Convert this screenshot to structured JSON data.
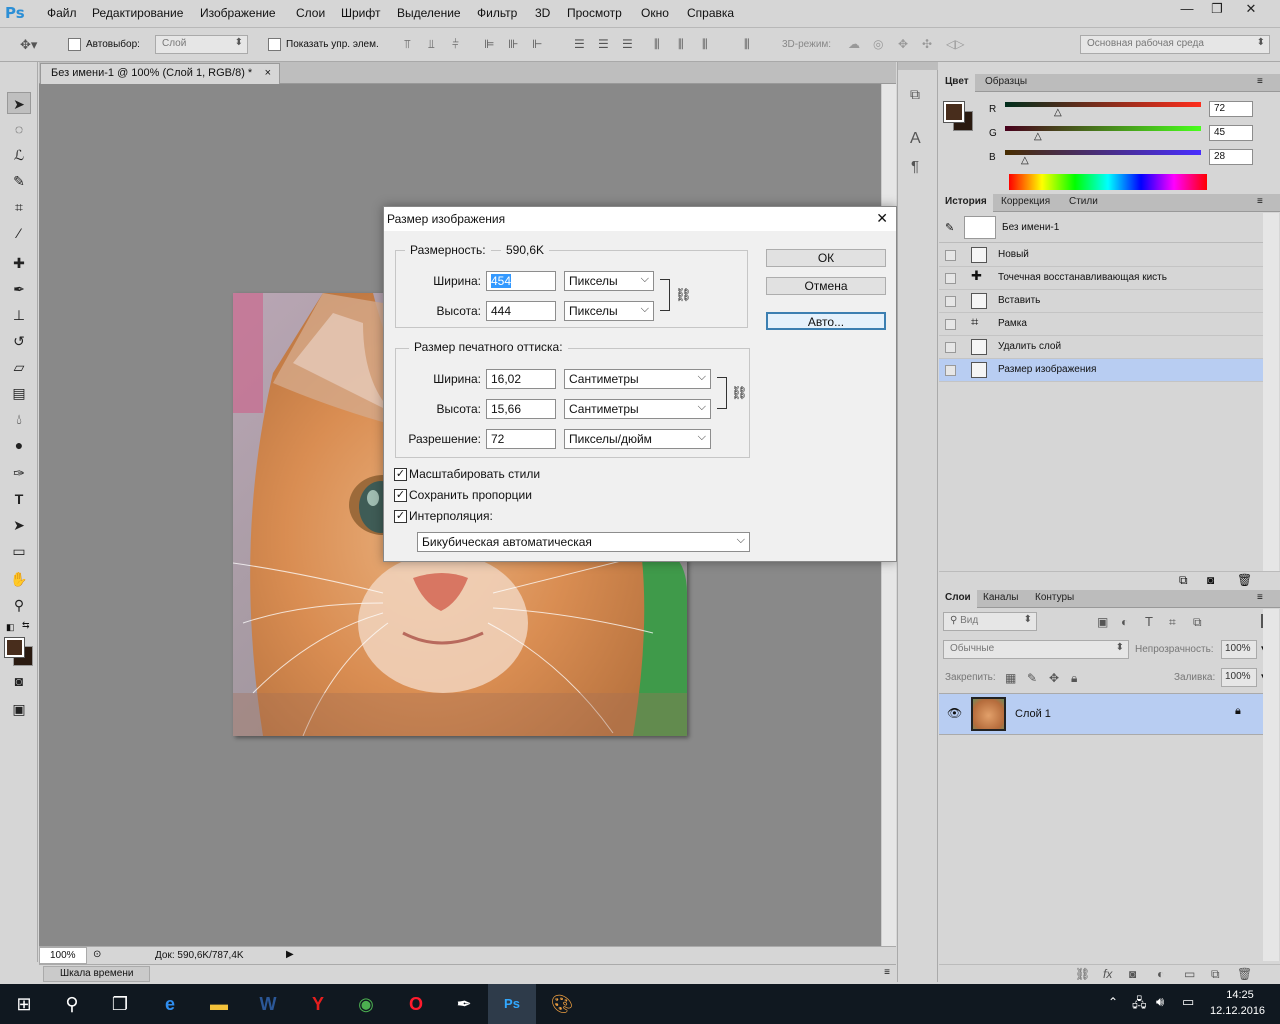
{
  "app": {
    "logo": "Ps"
  },
  "menu": [
    "Файл",
    "Редактирование",
    "Изображение",
    "Слои",
    "Шрифт",
    "Выделение",
    "Фильтр",
    "3D",
    "Просмотр",
    "Окно",
    "Справка"
  ],
  "window_controls": {
    "minimize": "—",
    "restore": "❐",
    "close": "✕"
  },
  "options": {
    "autoselect_label": "Автовыбор:",
    "autoselect_value": "Слой",
    "show_controls_label": "Показать упр. элем.",
    "mode3d_label": "3D-режим:",
    "workspace": "Основная рабочая среда"
  },
  "document": {
    "tab_title": "Без имени-1 @ 100% (Слой 1, RGB/8) *",
    "close": "×",
    "zoom": "100%",
    "doc_size": "Док: 590,6K/787,4K",
    "timeline": "Шкала времени"
  },
  "dialog": {
    "title": "Размер изображения",
    "close": "✕",
    "pixel_dims_label": "Размерность:",
    "pixel_dims_value": "590,6K",
    "width_label": "Ширина:",
    "height_label": "Высота:",
    "px_width": "454",
    "px_height": "444",
    "px_unit": "Пикселы",
    "print_title": "Размер печатного оттиска:",
    "print_width": "16,02",
    "print_height": "15,66",
    "print_unit": "Сантиметры",
    "resolution_label": "Разрешение:",
    "resolution": "72",
    "resolution_unit": "Пикселы/дюйм",
    "scale_styles": "Масштабировать стили",
    "constrain": "Сохранить пропорции",
    "resample": "Интерполяция:",
    "resample_method": "Бикубическая автоматическая",
    "ok": "ОК",
    "cancel": "Отмена",
    "auto": "Авто..."
  },
  "color_panel": {
    "tabs": [
      "Цвет",
      "Образцы"
    ],
    "r_label": "R",
    "g_label": "G",
    "b_label": "B",
    "r": "72",
    "g": "45",
    "b": "28",
    "fg_color": "#482d1c"
  },
  "history_panel": {
    "tabs": [
      "История",
      "Коррекция",
      "Стили"
    ],
    "snapshot": "Без имени-1",
    "items": [
      "Новый",
      "Точечная восстанавливающая кисть",
      "Вставить",
      "Рамка",
      "Удалить слой",
      "Размер изображения"
    ]
  },
  "layers_panel": {
    "tabs": [
      "Слои",
      "Каналы",
      "Контуры"
    ],
    "filter": "Вид",
    "blend": "Обычные",
    "opacity_label": "Непрозрачность:",
    "opacity": "100%",
    "lock_label": "Закрепить:",
    "fill_label": "Заливка:",
    "fill": "100%",
    "layer_name": "Слой 1"
  },
  "taskbar": {
    "time": "14:25",
    "date": "12.12.2016"
  }
}
